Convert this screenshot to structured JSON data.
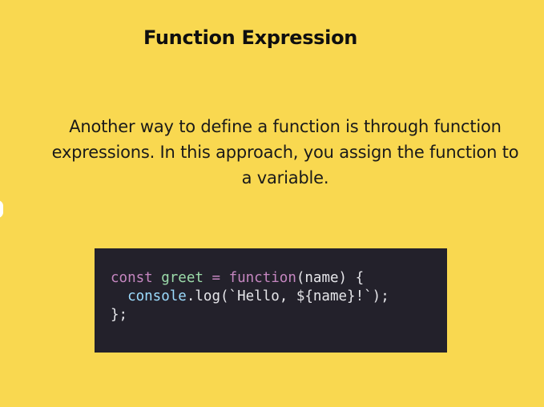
{
  "slide": {
    "title": "Function Expression",
    "body_lines": [
      "Another way to define a function is through function",
      "expressions. In this approach, you assign the function to",
      "a variable."
    ]
  },
  "code": {
    "line1": {
      "kw": "const",
      "name": "greet",
      "eq": "=",
      "fn": "function",
      "params": "(name) {"
    },
    "line2": {
      "obj": "console",
      "call": ".log(",
      "template": "`Hello, ${name}!`",
      "end": ");"
    },
    "line3": {
      "end": "};"
    }
  },
  "colors": {
    "background": "#f9d850",
    "code_background": "#23212b",
    "keyword": "#c586c0",
    "identifier": "#9cdcaa"
  }
}
